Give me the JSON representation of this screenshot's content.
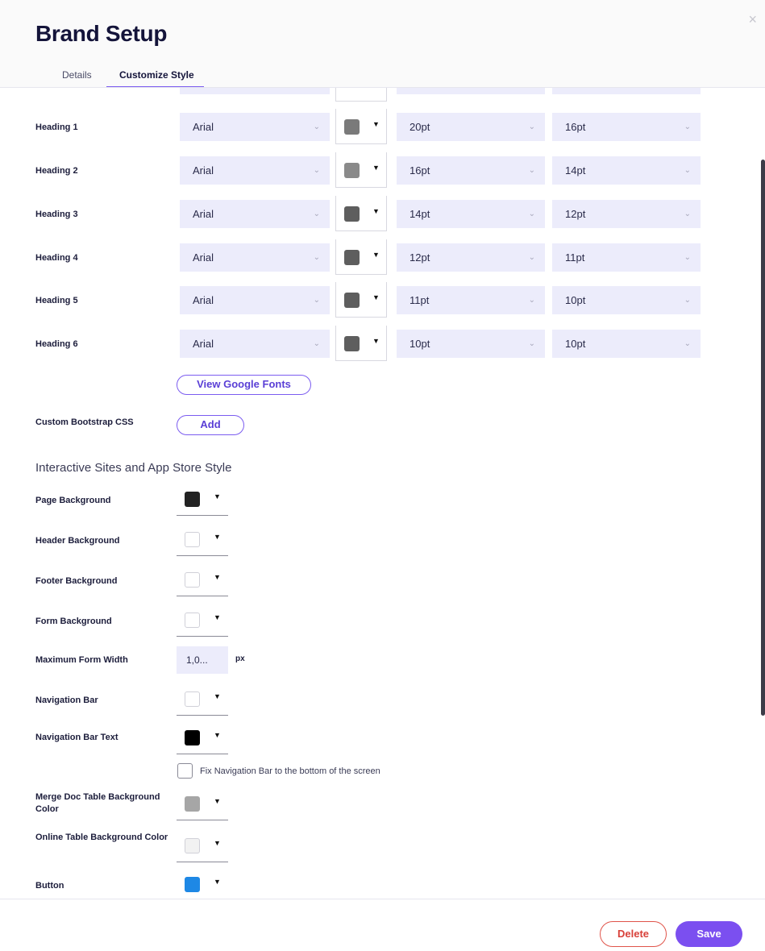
{
  "modal": {
    "title": "Brand Setup",
    "close_icon": "×"
  },
  "tabs": [
    {
      "label": "Details"
    },
    {
      "label": "Customize Style"
    }
  ],
  "headings": [
    {
      "label": "Heading 1",
      "font": "Arial",
      "color": "#7a7a7a",
      "size": "20pt",
      "size2": "16pt"
    },
    {
      "label": "Heading 2",
      "font": "Arial",
      "color": "#8a8a8a",
      "size": "16pt",
      "size2": "14pt"
    },
    {
      "label": "Heading 3",
      "font": "Arial",
      "color": "#5e5e5e",
      "size": "14pt",
      "size2": "12pt"
    },
    {
      "label": "Heading 4",
      "font": "Arial",
      "color": "#5e5e5e",
      "size": "12pt",
      "size2": "11pt"
    },
    {
      "label": "Heading 5",
      "font": "Arial",
      "color": "#5e5e5e",
      "size": "11pt",
      "size2": "10pt"
    },
    {
      "label": "Heading 6",
      "font": "Arial",
      "color": "#5e5e5e",
      "size": "10pt",
      "size2": "10pt"
    }
  ],
  "view_google_fonts": "View Google Fonts",
  "custom_css": {
    "label": "Custom Bootstrap CSS",
    "button": "Add"
  },
  "section_title": "Interactive Sites and App Store Style",
  "style_rows": [
    {
      "label": "Page Background",
      "color": "#222222"
    },
    {
      "label": "Header Background",
      "color": "#ffffff"
    },
    {
      "label": "Footer Background",
      "color": "#ffffff"
    },
    {
      "label": "Form Background",
      "color": "#ffffff"
    },
    {
      "label": "Navigation Bar",
      "color": "#ffffff"
    },
    {
      "label": "Navigation Bar Text",
      "color": "#000000"
    },
    {
      "label": "Merge Doc Table Background Color",
      "color": "#a6a6a6"
    },
    {
      "label": "Online Table Background Color",
      "color": "#f2f2f2"
    },
    {
      "label": "Button",
      "color": "#1e88e5"
    }
  ],
  "max_form_width": {
    "label": "Maximum Form Width",
    "value": "1,0...",
    "unit": "px"
  },
  "fix_nav": {
    "label": "Fix Navigation Bar to the bottom of the screen"
  },
  "footer": {
    "delete": "Delete",
    "save": "Save"
  },
  "accent": "#7b4ff0",
  "icons": {
    "chevron": "chevron-down-icon",
    "dropdown": "triangle-down-icon"
  }
}
